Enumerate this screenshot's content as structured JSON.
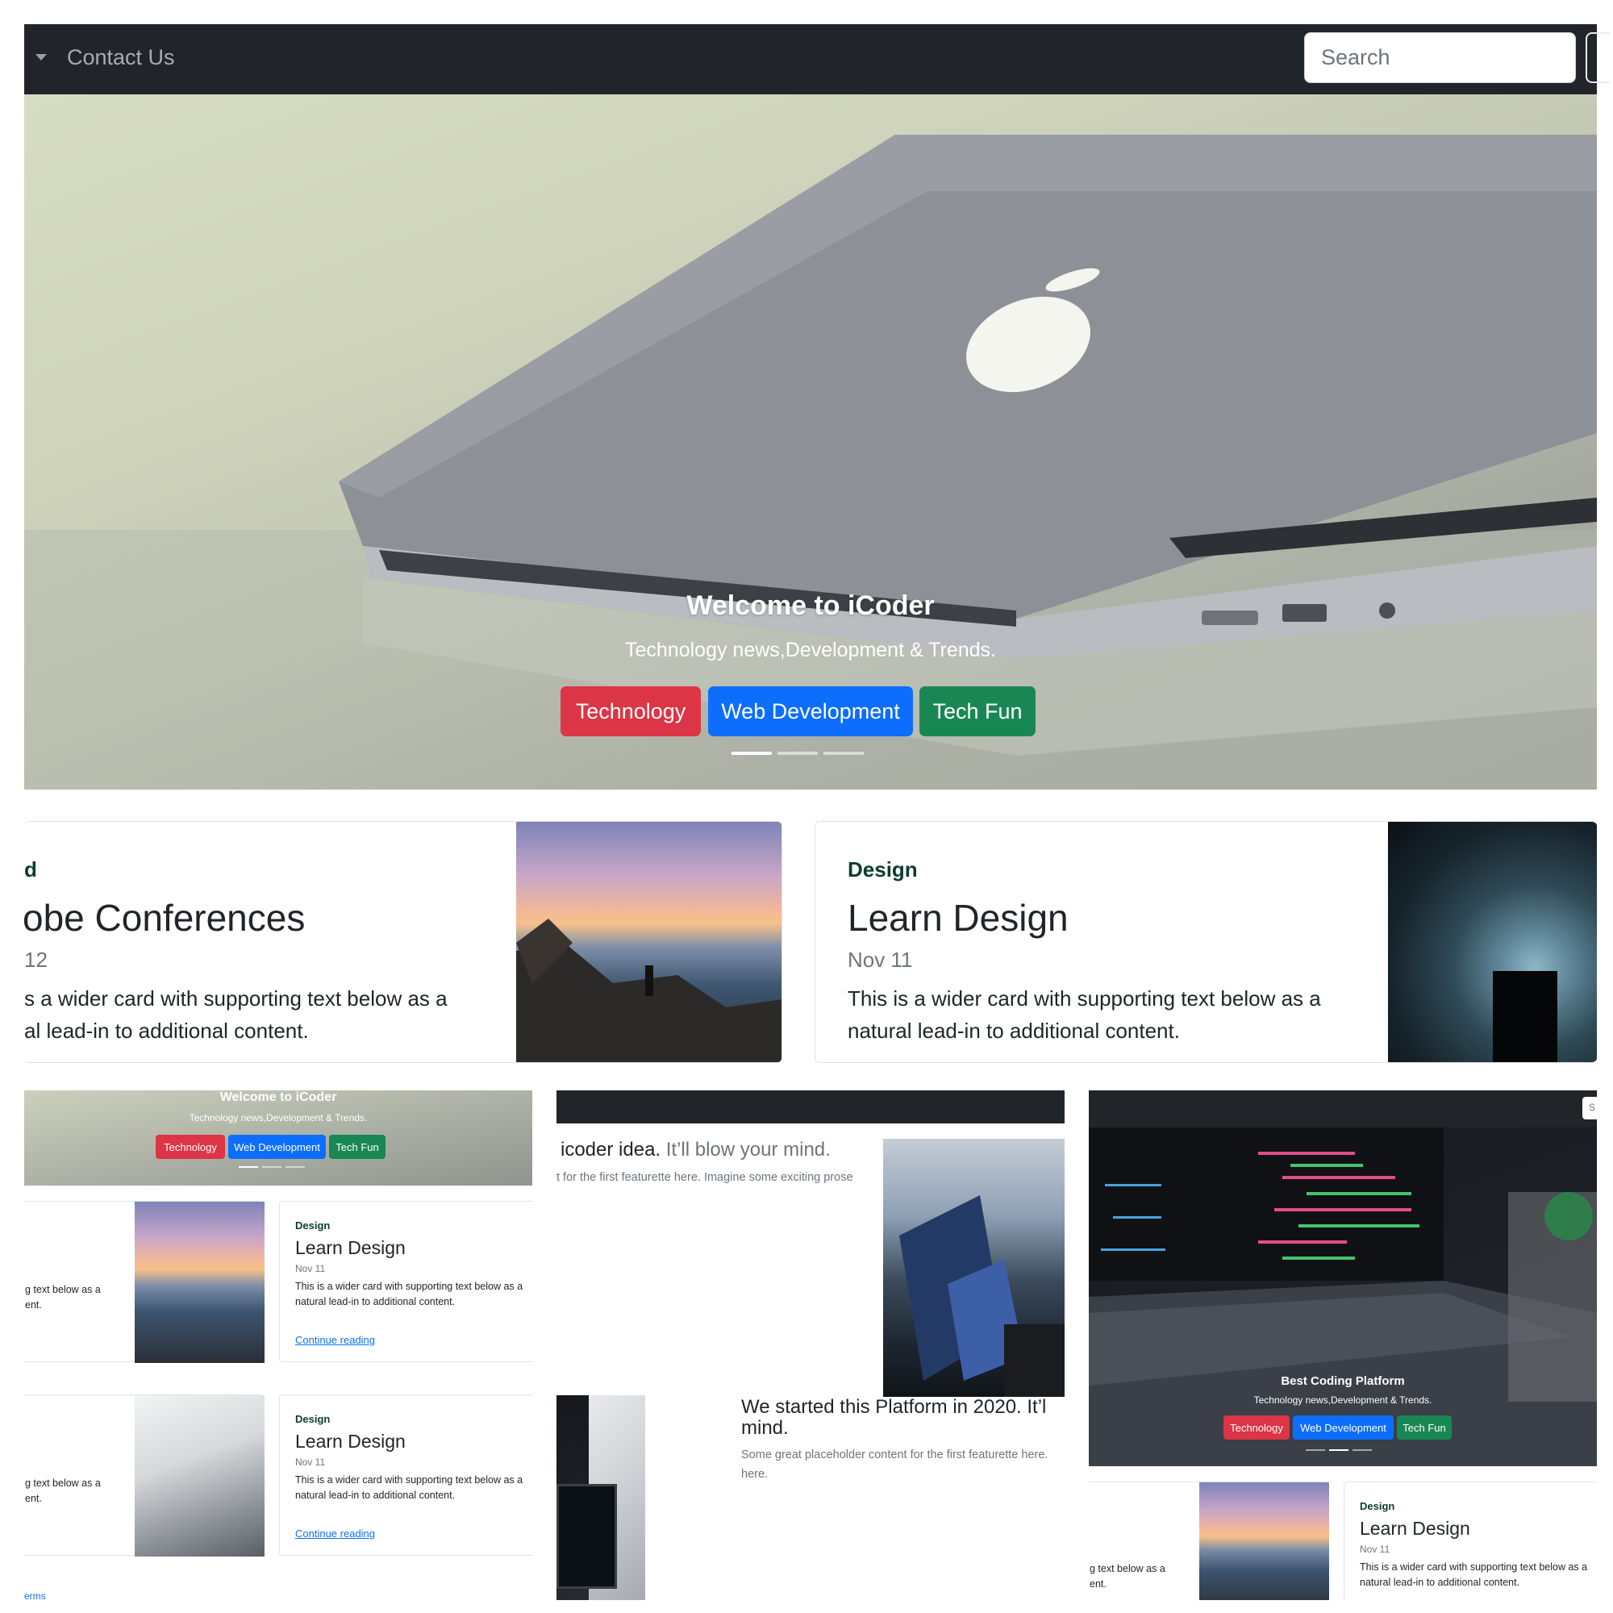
{
  "navbar": {
    "menu_item": "Contact Us",
    "search_placeholder": "Search"
  },
  "hero": {
    "title": "Welcome to iCoder",
    "subtitle": "Technology news,Development & Trends.",
    "buttons": [
      "Technology",
      "Web Development",
      "Tech Fun"
    ],
    "active_slide": 1,
    "slide_count": 3
  },
  "cards": [
    {
      "category": "d",
      "title": "obe Conferences",
      "date": "12",
      "text_line1": "s a wider card with supporting text below as a",
      "text_line2": "al lead-in to additional content."
    },
    {
      "category": "Design",
      "title": "Learn Design",
      "date": "Nov 11",
      "text_line1": "This is a wider card with supporting text below as a",
      "text_line2": "natural lead-in to additional content."
    }
  ],
  "panel_left": {
    "hero_title": "Welcome to iCoder",
    "hero_subtitle": "Technology news,Development & Trends.",
    "buttons": [
      "Technology",
      "Web Development",
      "Tech Fun"
    ],
    "partial_text_line1": "g text below as a",
    "partial_text_line2": "ent.",
    "cards": [
      {
        "category": "Design",
        "title": "Learn Design",
        "date": "Nov 11",
        "text_line1": "This is a wider card with supporting text below as a",
        "text_line2": "natural lead-in to additional content.",
        "link": "Continue reading"
      },
      {
        "category": "Design",
        "title": "Learn Design",
        "date": "Nov 11",
        "text_line1": "This is a wider card with supporting text below as a",
        "text_line2": "natural lead-in to additional content.",
        "link": "Continue reading"
      }
    ],
    "footer_link": "erms"
  },
  "panel_middle": {
    "featurette1_heading_strong": "icoder idea.",
    "featurette1_heading_muted": "It’ll blow your mind.",
    "featurette1_text": "t for the first featurette here. Imagine some exciting prose",
    "featurette2_heading": "We started this Platform in 2020. It’l",
    "featurette2_heading_line2": "mind.",
    "featurette2_text_line1": "Some great placeholder content for the first featurette here.",
    "featurette2_text_line2": "here."
  },
  "panel_right": {
    "search_fragment": "S",
    "hero_title": "Best Coding Platform",
    "hero_subtitle": "Technology news,Development & Trends.",
    "buttons": [
      "Technology",
      "Web Development",
      "Tech Fun"
    ],
    "partial_text_line1": "g text below as a",
    "partial_text_line2": "ent.",
    "card": {
      "category": "Design",
      "title": "Learn Design",
      "date": "Nov 11",
      "text_line1": "This is a wider card with supporting text below as a",
      "text_line2": "natural lead-in to additional content."
    }
  },
  "colors": {
    "navbar_bg": "#212529",
    "danger": "#dc3545",
    "primary": "#0d6efd",
    "success": "#198754"
  }
}
